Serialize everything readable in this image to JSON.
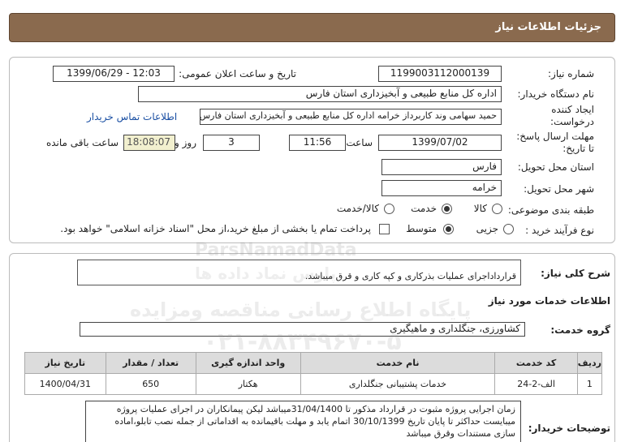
{
  "header": {
    "title": "جزئیات اطلاعات نیاز"
  },
  "need": {
    "number_label": "شماره نیاز:",
    "number": "1199003112000139",
    "announce_label": "تاریخ و ساعت اعلان عمومی:",
    "announce_value": "1399/06/29 - 12:03",
    "buyer_label": "نام دستگاه خریدار:",
    "buyer": "اداره کل منابع طبیعی و آبخیزداری استان فارس",
    "creator_label_1": "ایجاد کننده",
    "creator_label_2": "درخواست:",
    "creator": "حمید سهامی وند کاربرداز خرامه اداره کل منابع طبیعی و آبخیزداری استان فارس",
    "contact_link": "اطلاعات تماس خریدار",
    "deadline_label_1": "مهلت ارسال پاسخ:",
    "deadline_label_2": "تا تاریخ:",
    "deadline_date": "1399/07/02",
    "time_label": "ساعت",
    "deadline_time": "11:56",
    "days": "3",
    "days_label": "روز و",
    "remaining_time": "18:08:07",
    "remaining_label": "ساعت باقی مانده",
    "province_label": "استان محل تحویل:",
    "province": "فارس",
    "city_label": "شهر محل تحویل:",
    "city": "خرامه",
    "category_label": "طبقه بندی موضوعی:",
    "category_options": [
      "کالا",
      "خدمت",
      "کالا/خدمت"
    ],
    "category_selected": "خدمت",
    "purchase_label": "نوع فرآیند خرید :",
    "purchase_options": [
      "جزیی",
      "متوسط"
    ],
    "purchase_selected": "متوسط",
    "payment_note": "پرداخت تمام یا بخشی از مبلغ خرید،از محل \"اسناد خزانه اسلامی\" خواهد بود."
  },
  "summary": {
    "label": "شرح کلی نیاز:",
    "text": "قرارداداجرای عملیات بذرکاری و کپه کاری و قرق میباشد."
  },
  "services": {
    "section_title": "اطلاعات خدمات مورد نیاز",
    "group_label": "گروه خدمت:",
    "group": "کشاورزی، جنگلداری و ماهیگیری",
    "columns": [
      "ردیف",
      "کد خدمت",
      "نام خدمت",
      "واحد اندازه گیری",
      "تعداد / مقدار",
      "تاریخ نیاز"
    ],
    "rows": [
      [
        "1",
        "الف-2-24",
        "خدمات پشتیبانی جنگلداری",
        "هکتار",
        "650",
        "1400/04/31"
      ]
    ]
  },
  "buyer_notes": {
    "label": "توضیحات خریدار:",
    "text": "زمان اجرایی پروژه مثبوت در قرارداد مذکور تا 31/04/1400میباشد لیکن پیمانکاران در اجرای عملیات پروژه میبایست حداکثر تا پایان تاریخ 30/10/1399 اتمام یابد و مهلت  باقیمانده به اقداماتی از جمله نصب تابلو،اماده سازی مستندات وقرق میباشد"
  },
  "watermark": {
    "latin": "ParsNamadData",
    "line1": "پایگاه اطلاع رسانی مناقصه ومزایده",
    "phone": "۰۲۱-۸۸۳۴۹۶۷۰-۵",
    "line0": "پارس نماد داده ها"
  }
}
